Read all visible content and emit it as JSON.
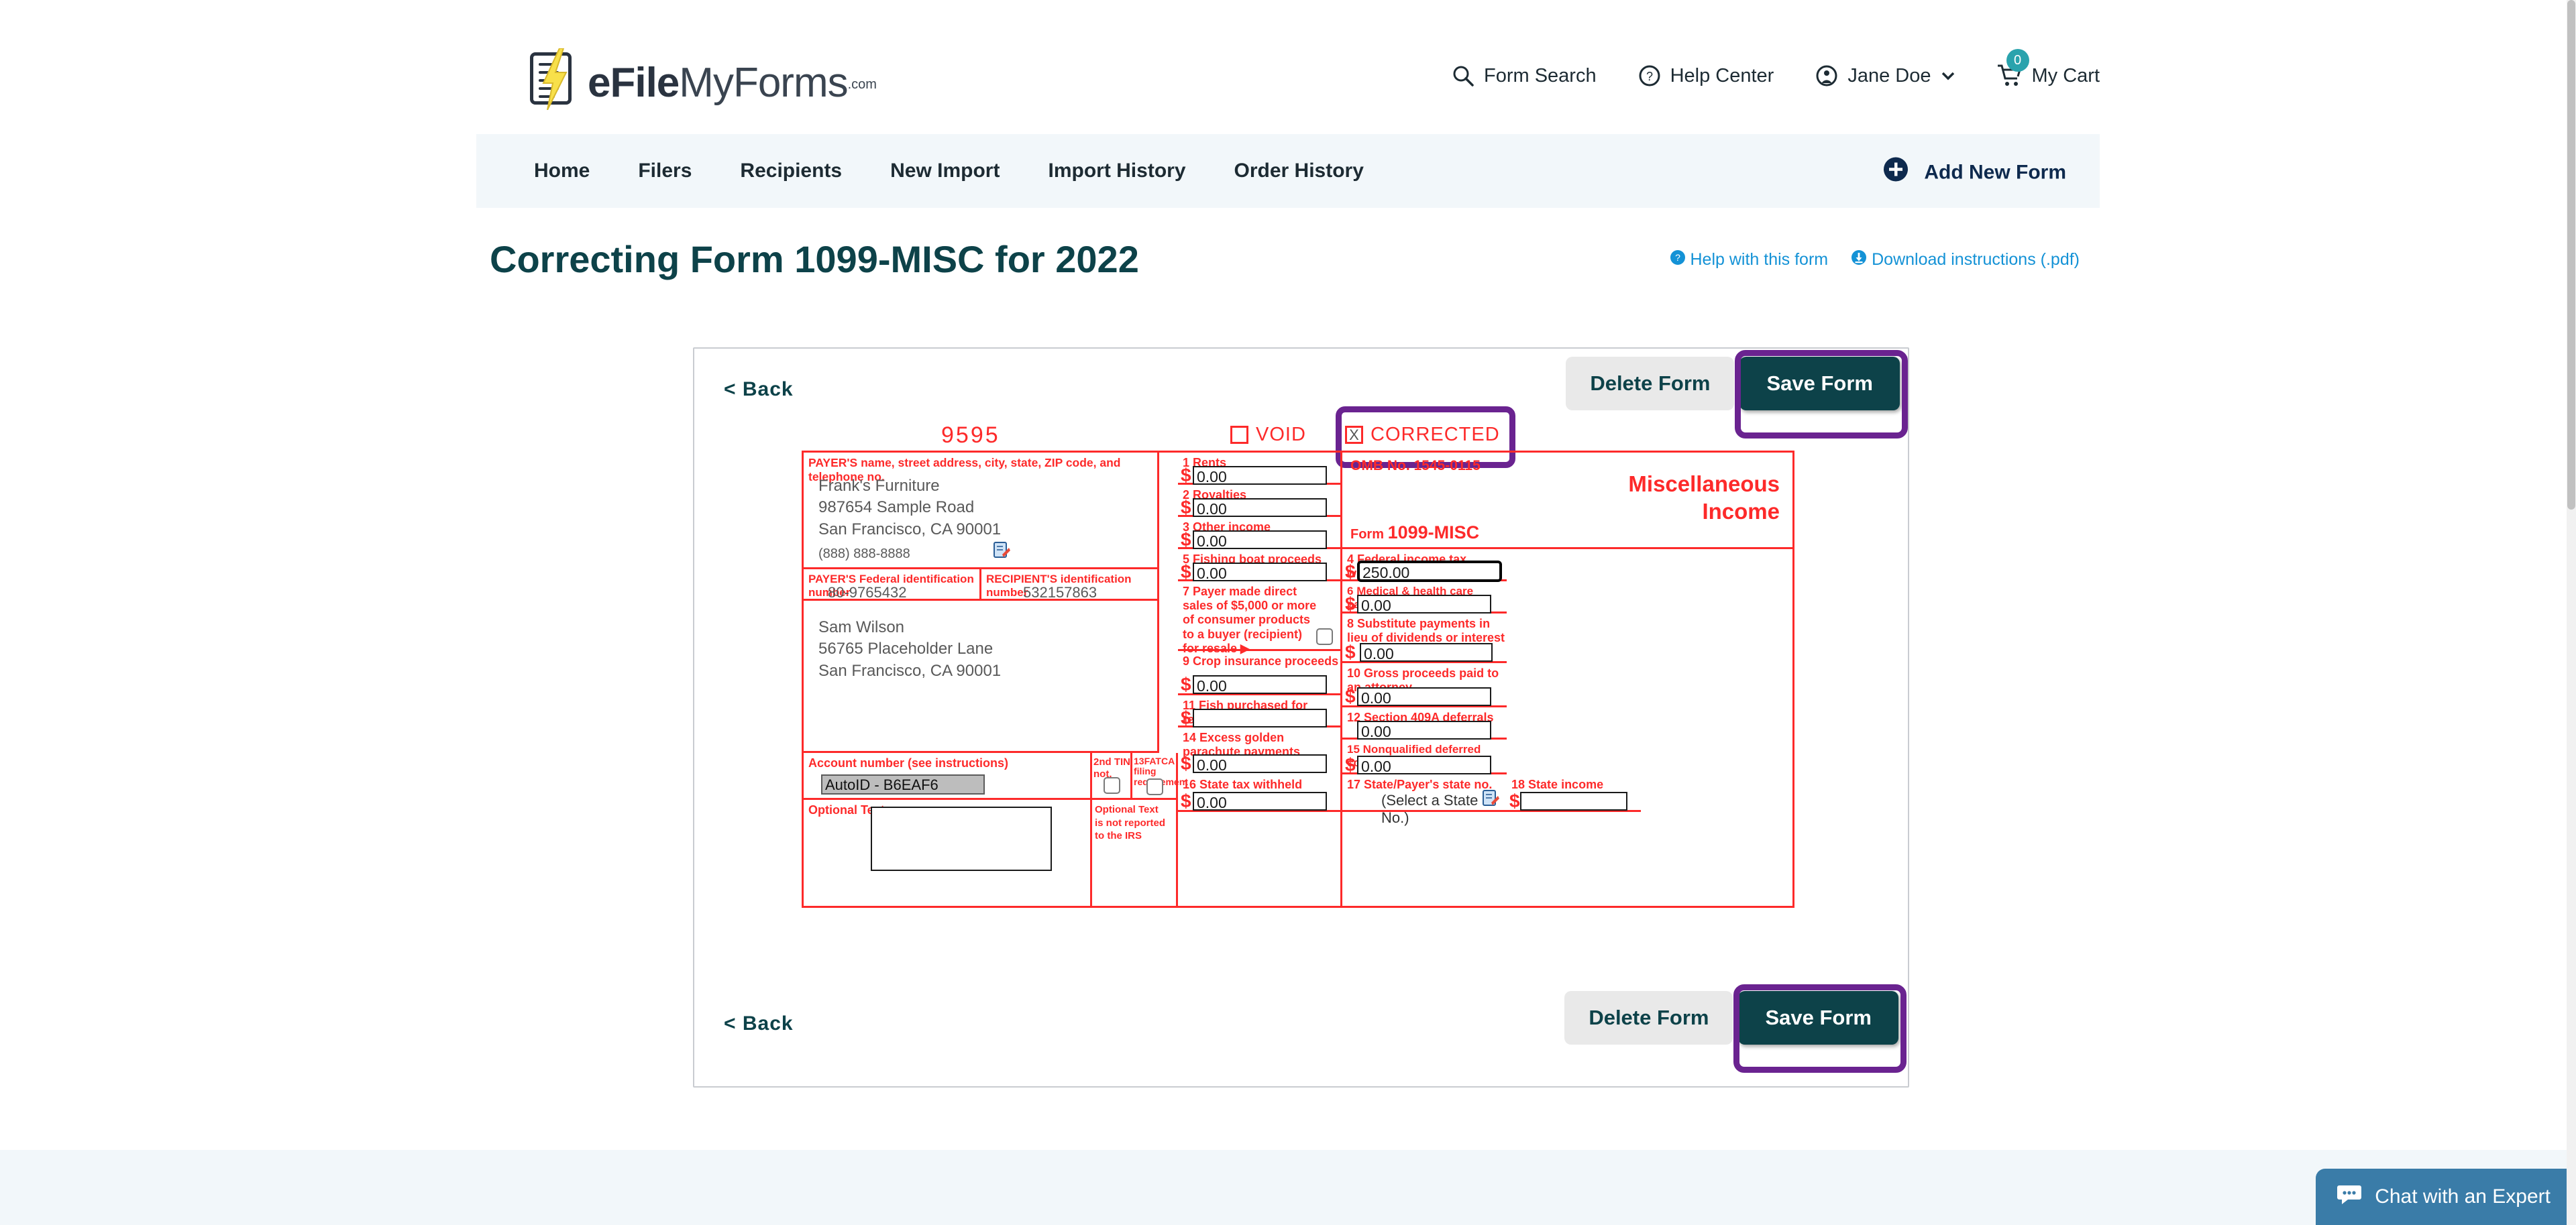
{
  "brand": {
    "name_bold": "eFile",
    "name_light": "MyForms",
    "domain": ".com",
    "logo_icon": "document-lightning-icon"
  },
  "header": {
    "actions": [
      {
        "label": "Form Search",
        "icon": "search-icon"
      },
      {
        "label": "Help Center",
        "icon": "question-circle-icon"
      },
      {
        "label": "Jane Doe",
        "icon": "user-circle-icon",
        "chevron": "chevron-down-icon"
      },
      {
        "label": "My Cart",
        "icon": "cart-icon",
        "badge": "0"
      }
    ]
  },
  "nav": {
    "items": [
      {
        "label": "Home"
      },
      {
        "label": "Filers"
      },
      {
        "label": "Recipients"
      },
      {
        "label": "New Import"
      },
      {
        "label": "Import History"
      },
      {
        "label": "Order History"
      }
    ],
    "add_form": {
      "label": "Add New Form",
      "icon": "plus-circle-icon"
    }
  },
  "page": {
    "title": "Correcting Form 1099-MISC for 2022",
    "links": [
      {
        "label": "Help with this form",
        "icon": "question-circle-icon"
      },
      {
        "label": "Download instructions (.pdf)",
        "icon": "download-circle-icon"
      }
    ]
  },
  "toolbar": {
    "back_label": "< Back",
    "delete_label": "Delete Form",
    "save_label": "Save Form"
  },
  "form": {
    "form_id": "9595",
    "void": {
      "label": "VOID",
      "checked_mark": ""
    },
    "corrected": {
      "label": "CORRECTED",
      "checked_mark": "X"
    },
    "omb": "OMB No.  1545-0115",
    "form_line_prefix": "Form ",
    "form_line_name": "1099-MISC",
    "doc_title_line1": "Miscellaneous",
    "doc_title_line2": "Income",
    "payer": {
      "header": "PAYER'S name, street address, city, state, ZIP code, and telephone no.",
      "name": "Frank's Furniture",
      "street": "987654 Sample Road",
      "citystatezip": "San Francisco, CA 90001",
      "phone": "(888) 888-8888",
      "edit_icon": "edit-pencil-icon"
    },
    "tins": {
      "payer_label": "PAYER'S Federal identification number",
      "payer_value": "80-9765432",
      "recipient_label": "RECIPIENT'S identification number",
      "recipient_value": "532157863"
    },
    "recipient": {
      "name": "Sam Wilson",
      "street": "56765 Placeholder Lane",
      "citystatezip": "San Francisco, CA 90001"
    },
    "boxes": [
      {
        "num": "1",
        "label": "Rents",
        "value": "0.00",
        "dollar": true
      },
      {
        "num": "2",
        "label": "Royalties",
        "value": "0.00",
        "dollar": true
      },
      {
        "num": "3",
        "label": "Other income",
        "value": "0.00",
        "dollar": true
      },
      {
        "num": "4",
        "label": "Federal income tax withheld",
        "value": "250.00",
        "dollar": true,
        "focused": true
      },
      {
        "num": "5",
        "label": "Fishing boat proceeds",
        "value": "0.00",
        "dollar": true
      },
      {
        "num": "6",
        "label": "Medical & health care payments",
        "value": "0.00",
        "dollar": true
      },
      {
        "num": "7",
        "label": "Payer made direct sales of $5,000 or more of consumer products to a buyer (recipient) for resale  ▶",
        "value": "",
        "checkbox": true
      },
      {
        "num": "8",
        "label": "Substitute payments in lieu of dividends or interest",
        "value": "0.00",
        "dollar": true
      },
      {
        "num": "9",
        "label": "Crop insurance proceeds",
        "value": "0.00",
        "dollar": true
      },
      {
        "num": "10",
        "label": "Gross proceeds paid to an attorney",
        "value": "0.00",
        "dollar": true
      },
      {
        "num": "11",
        "label": "Fish purchased for resale",
        "value": "",
        "dollar": true
      },
      {
        "num": "12",
        "label": "Section 409A deferrals",
        "value": "0.00",
        "dollar": false
      },
      {
        "num": "13",
        "label": "FATCA filing requirement",
        "checkbox": true
      },
      {
        "num": "14",
        "label": "Excess golden parachute payments",
        "value": "0.00",
        "dollar": true
      },
      {
        "num": "15",
        "label": "Nonqualified deferred compensation",
        "value": "0.00",
        "dollar": true
      },
      {
        "num": "16",
        "label": "State tax withheld",
        "value": "0.00",
        "dollar": true
      },
      {
        "num": "17",
        "label": "State/Payer's state no.",
        "value": "(Select a State No.)",
        "edit_icon": "edit-pencil-icon"
      },
      {
        "num": "18",
        "label": "State income",
        "value": "",
        "dollar": true
      }
    ],
    "account": {
      "label": "Account number (see instructions)",
      "value": "AutoID - B6EAF6"
    },
    "second_tin": {
      "label": "2nd TIN not."
    },
    "optional_left": {
      "label": "Optional Text",
      "value": ""
    },
    "optional_right": {
      "line1": "Optional Text",
      "line2": "is not reported",
      "line3": "to the IRS"
    }
  },
  "chat": {
    "label": "Chat with an Expert",
    "icon": "chat-bubble-icon"
  },
  "colors": {
    "brand_teal": "#0d4249",
    "accent_blue": "#1492d6",
    "form_red": "#fd2a2a",
    "highlight_purple": "#6a2390",
    "nav_bg": "#f2f7fa",
    "cart_badge": "#2aa3ad",
    "chat_blue": "#3a7ca8"
  }
}
